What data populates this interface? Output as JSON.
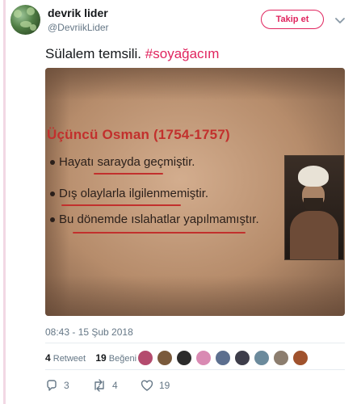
{
  "user": {
    "name": "devrik lider",
    "handle": "@DevriikLider"
  },
  "follow_label": "Takip et",
  "tweet": {
    "text": "Sülalem temsili.",
    "hashtag": "#soyağacım"
  },
  "photo": {
    "heading": "Üçüncü Osman (1754-1757)",
    "lines": [
      "Hayatı sarayda geçmiştir.",
      "Dış olaylarla ilgilenmemiştir.",
      "Bu dönemde ıslahatlar yapılmamıştır."
    ]
  },
  "timestamp": "08:43 - 15 Şub 2018",
  "stats": {
    "retweet_count": "4",
    "retweet_label": "Retweet",
    "like_count": "19",
    "like_label": "Beğeni"
  },
  "likers": [
    {
      "color": "#b44b6e"
    },
    {
      "color": "#7a5a3c"
    },
    {
      "color": "#2b2b2b"
    },
    {
      "color": "#d98ab3"
    },
    {
      "color": "#5c6f8f"
    },
    {
      "color": "#3d3d4a"
    },
    {
      "color": "#6b8a9c"
    },
    {
      "color": "#8c7d6e"
    },
    {
      "color": "#a0522d"
    }
  ],
  "actions": {
    "reply_count": "3",
    "retweet_count": "4",
    "like_count": "19"
  },
  "colors": {
    "accent": "#e0245e",
    "muted": "#657786"
  },
  "icons": [
    "reply-icon",
    "retweet-icon",
    "heart-icon",
    "chevron-down-icon"
  ]
}
